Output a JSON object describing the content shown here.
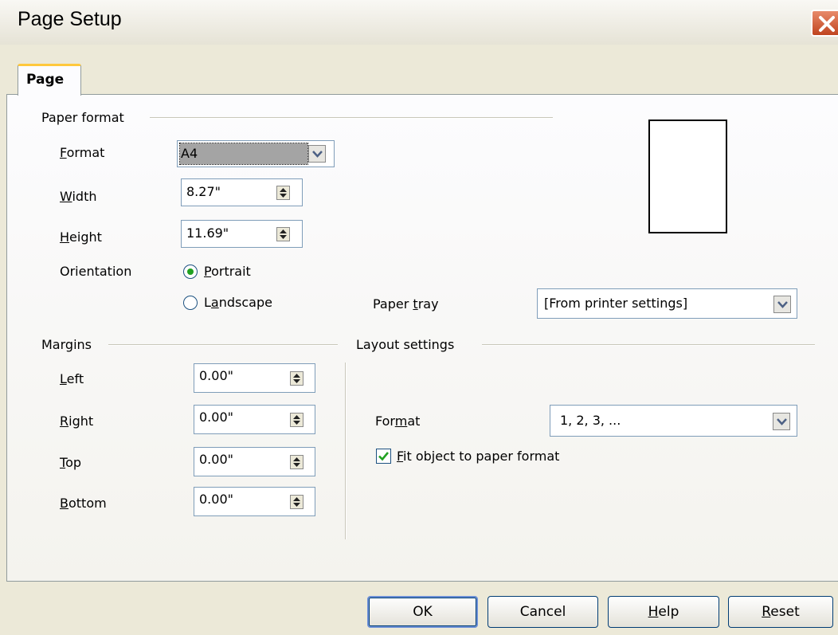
{
  "window": {
    "title": "Page Setup"
  },
  "tabs": [
    {
      "label": "Page"
    }
  ],
  "paper_format": {
    "section_label": "Paper format",
    "format": {
      "label_key": "F",
      "label_rest": "ormat",
      "value": "A4"
    },
    "width": {
      "label_key": "W",
      "label_rest": "idth",
      "value": "8.27\""
    },
    "height": {
      "label_key": "H",
      "label_rest": "eight",
      "value": "11.69\""
    },
    "orientation": {
      "label": "Orientation",
      "portrait": {
        "key": "P",
        "rest": "ortrait",
        "selected": true
      },
      "landscape": {
        "pre": "L",
        "key": "a",
        "rest": "ndscape",
        "selected": false
      }
    },
    "paper_tray": {
      "label_pre": "Paper ",
      "label_key": "t",
      "label_rest": "ray",
      "value": "[From printer settings]"
    }
  },
  "margins": {
    "section_label": "Margins",
    "left": {
      "label_key": "L",
      "label_rest": "eft",
      "value": "0.00\""
    },
    "right": {
      "label_key": "R",
      "label_rest": "ight",
      "value": "0.00\""
    },
    "top": {
      "label_key": "T",
      "label_rest": "op",
      "value": "0.00\""
    },
    "bottom": {
      "label_key": "B",
      "label_rest": "ottom",
      "value": "0.00\""
    }
  },
  "layout_settings": {
    "section_label": "Layout settings",
    "format": {
      "label_pre": "For",
      "label_key": "m",
      "label_rest": "at",
      "value": "1, 2, 3, ..."
    },
    "fit_object": {
      "label_key": "F",
      "label_rest": "it object to paper format",
      "checked": true
    }
  },
  "buttons": {
    "ok": "OK",
    "cancel": "Cancel",
    "help": {
      "key": "H",
      "rest": "elp"
    },
    "reset": {
      "key": "R",
      "rest": "eset"
    }
  },
  "colors": {
    "window_bg": "#ece9d8",
    "field_border": "#7f9db9",
    "tab_highlight": "#ffc83c",
    "check_green": "#21a121",
    "close_red": "#c0441f"
  },
  "icons": {
    "close": "close-x-icon",
    "dropdown": "chevron-down-icon",
    "spin": "spin-updown-icon",
    "check": "checkmark-icon"
  }
}
